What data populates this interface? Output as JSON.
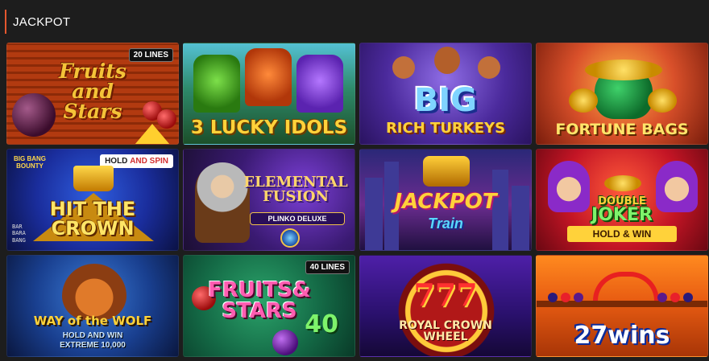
{
  "section": {
    "title": "JACKPOT"
  },
  "games": [
    {
      "title_line1": "Fruits",
      "title_line2": "and",
      "title_line3": "Stars",
      "badge": "20 LINES"
    },
    {
      "title": "3 LUCKY IDOLS"
    },
    {
      "big": "BIG",
      "title": "RICH TURKEYS"
    },
    {
      "title": "FORTUNE BAGS"
    },
    {
      "badge_hold": "HOLD",
      "badge_spin": "AND SPIN",
      "small": "BIG BANG BOUNTY",
      "title_line1": "HIT THE",
      "title_line2": "CROWN",
      "bar": "BAR\nBARA\nBANG"
    },
    {
      "title_line1": "ELEMENTAL",
      "title_line2": "FUSION",
      "sub": "PLINKO DELUXE"
    },
    {
      "title_line1": "JACKPOT",
      "title_line2": "Train"
    },
    {
      "title_line1": "DOUBLE",
      "title_line2": "JOKER",
      "sub": "HOLD & WIN"
    },
    {
      "title": "WAY of the WOLF",
      "sub_line1": "HOLD AND WIN",
      "sub_line2": "EXTREME 10,000"
    },
    {
      "title_line1": "FRUITS&",
      "title_line2": "STARS",
      "num": "40",
      "badge": "40 LINES"
    },
    {
      "sevens": "777",
      "title_line1": "ROYAL CROWN",
      "title_line2": "WHEEL"
    },
    {
      "title": "27wins"
    }
  ]
}
